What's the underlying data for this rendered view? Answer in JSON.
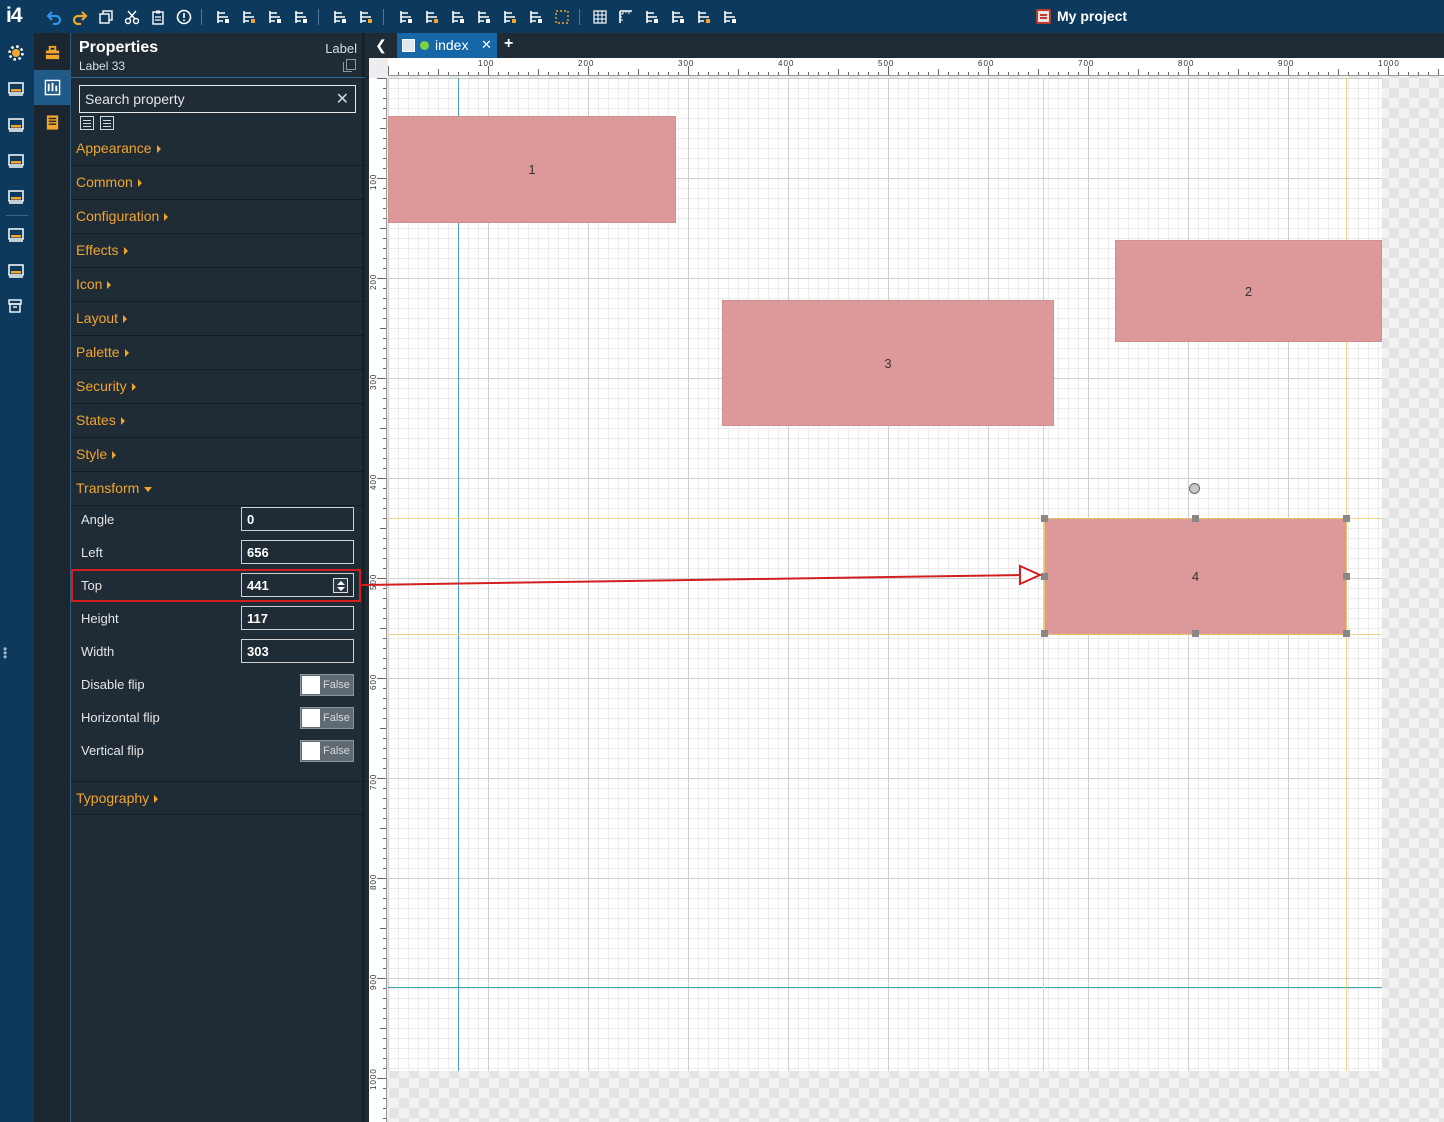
{
  "app": {
    "logo": "i4",
    "project_name": "My project"
  },
  "toolbar": {
    "groups": [
      [
        "undo-icon",
        "redo-icon",
        "duplicate-icon",
        "cut-icon",
        "paste-icon",
        "info-icon"
      ],
      [
        "align-top-icon",
        "align-bottom-icon",
        "bring-forward-icon",
        "send-backward-icon"
      ],
      [
        "distribute-horizontal-icon",
        "distribute-vertical-icon"
      ],
      [
        "align-left-icon",
        "align-center-icon",
        "align-right-icon",
        "align-top-edge-icon",
        "align-middle-icon",
        "align-bottom-edge-icon",
        "select-area-icon"
      ],
      [
        "grid-icon",
        "ruler-icon",
        "snap-grid-icon",
        "snap-lines-icon",
        "group-icon",
        "ungroup-icon"
      ]
    ]
  },
  "rail": [
    "settings-icon",
    "dashboard-icon",
    "hardhat-icon",
    "screen-chart-icon",
    "printer-icon",
    "package-icon",
    "device-settings-icon",
    "archive-icon"
  ],
  "properties": {
    "title": "Properties",
    "subtitle": "Label 33",
    "type": "Label",
    "search_placeholder": "Search property",
    "categories_top": [
      "Appearance",
      "Common",
      "Configuration",
      "Effects",
      "Icon",
      "Layout",
      "Palette",
      "Security",
      "States",
      "Style"
    ],
    "transform": {
      "label": "Transform",
      "fields": [
        {
          "label": "Angle",
          "value": "0"
        },
        {
          "label": "Left",
          "value": "656"
        },
        {
          "label": "Top",
          "value": "441"
        },
        {
          "label": "Height",
          "value": "117"
        },
        {
          "label": "Width",
          "value": "303"
        }
      ],
      "toggles": [
        {
          "label": "Disable flip",
          "value": "False"
        },
        {
          "label": "Horizontal flip",
          "value": "False"
        },
        {
          "label": "Vertical flip",
          "value": "False"
        }
      ]
    },
    "categories_bottom": [
      "Typography"
    ]
  },
  "tabs": {
    "active": "index"
  },
  "rulers": {
    "top": [
      "100",
      "200",
      "300",
      "400",
      "500",
      "600",
      "700",
      "800",
      "900",
      "1000"
    ],
    "left": [
      "100",
      "200",
      "300",
      "400",
      "500",
      "600",
      "700",
      "800",
      "900",
      "1000"
    ]
  },
  "widgets": [
    {
      "label": "1"
    },
    {
      "label": "2"
    },
    {
      "label": "3"
    },
    {
      "label": "4"
    }
  ],
  "colors": {
    "accent": "#f2a52c",
    "widget": "#dd9999",
    "highlight": "#d11f1f",
    "topbar": "#0d3a5c"
  }
}
